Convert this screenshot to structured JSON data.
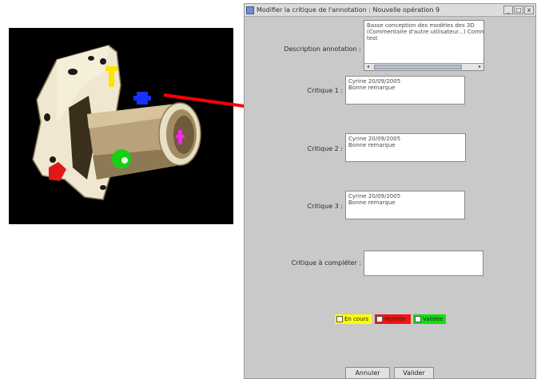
{
  "dialog": {
    "title": "Modifier la critique de l'annotation : Nouvelle opération 9",
    "window_buttons": [
      "_",
      "□",
      "x"
    ]
  },
  "fields": {
    "description_label": "Description annotation :",
    "description_lines": [
      "Basse conception des modèles des 3D",
      "(Commentaire d'autre utilisateur...) Commentaire",
      "test"
    ],
    "critique1_label": "Critique 1 :",
    "critique1_lines": [
      "Cyrine 20/09/2005",
      "Bonne remarque"
    ],
    "critique2_label": "Critique 2 :",
    "critique2_lines": [
      "Cyrine 20/09/2005",
      "Bonne remarque"
    ],
    "critique3_label": "Critique 3 :",
    "critique3_lines": [
      "Cyrine 20/09/2005",
      "Bonne remarque"
    ],
    "critique_compile_label": "Critique à compléter :",
    "critique_compile_value": ""
  },
  "status_options": [
    {
      "label": "En cours",
      "color": "#ffff00"
    },
    {
      "label": "Rejetée",
      "color": "#ff1010"
    },
    {
      "label": "Validée",
      "color": "#10e010"
    }
  ],
  "buttons": {
    "cancel": "Annuler",
    "validate": "Valider"
  },
  "colors": {
    "arrow": "#ff0000",
    "viewport_background": "#000000"
  }
}
